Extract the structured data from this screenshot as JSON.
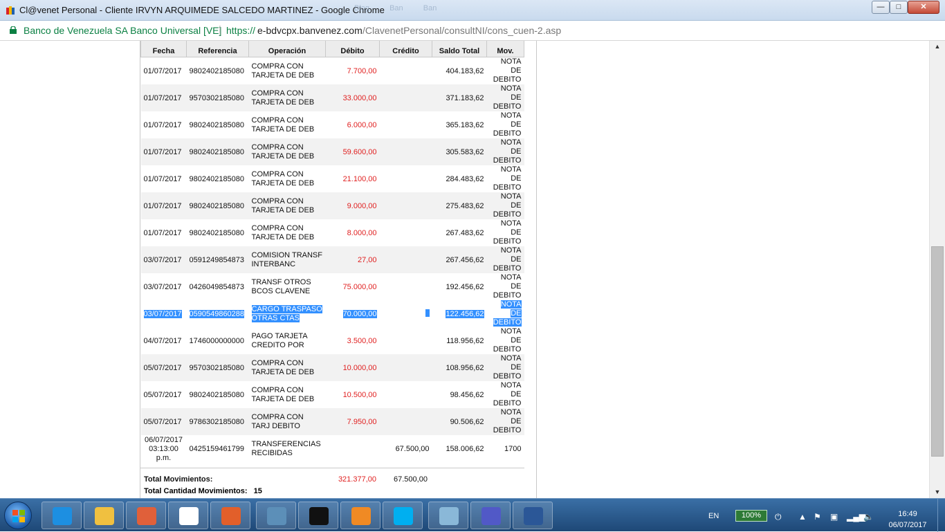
{
  "window": {
    "title": "Cl@venet Personal - Cliente IRVYN ARQUIMEDE SALCEDO MARTINEZ - Google Chrome",
    "ghost_tabs": [
      "Blog",
      "Ban",
      "Ban"
    ],
    "controls": {
      "minimize": "—",
      "maximize": "□",
      "close": "✕"
    }
  },
  "address": {
    "org": "Banco de Venezuela SA Banco Universal [VE]",
    "separator": "|",
    "scheme": "https://",
    "domain": "e-bdvcpx.banvenez.com",
    "path": "/ClavenetPersonal/consultNI/cons_cuen-2.asp"
  },
  "table": {
    "headers": {
      "fecha": "Fecha",
      "referencia": "Referencia",
      "operacion": "Operación",
      "debito": "Débito",
      "credito": "Crédito",
      "saldo": "Saldo Total",
      "tipo": "Mov."
    },
    "rows": [
      {
        "fecha": "01/07/2017",
        "referencia": "9802402185080",
        "operacion": "COMPRA CON TARJETA DE DEB",
        "debito": "7.700,00",
        "credito": "",
        "saldo": "404.183,62",
        "tipo": "NOTA DE DEBITO"
      },
      {
        "fecha": "01/07/2017",
        "referencia": "9570302185080",
        "operacion": "COMPRA CON TARJETA DE DEB",
        "debito": "33.000,00",
        "credito": "",
        "saldo": "371.183,62",
        "tipo": "NOTA DE DEBITO"
      },
      {
        "fecha": "01/07/2017",
        "referencia": "9802402185080",
        "operacion": "COMPRA CON TARJETA DE DEB",
        "debito": "6.000,00",
        "credito": "",
        "saldo": "365.183,62",
        "tipo": "NOTA DE DEBITO"
      },
      {
        "fecha": "01/07/2017",
        "referencia": "9802402185080",
        "operacion": "COMPRA CON TARJETA DE DEB",
        "debito": "59.600,00",
        "credito": "",
        "saldo": "305.583,62",
        "tipo": "NOTA DE DEBITO"
      },
      {
        "fecha": "01/07/2017",
        "referencia": "9802402185080",
        "operacion": "COMPRA CON TARJETA DE DEB",
        "debito": "21.100,00",
        "credito": "",
        "saldo": "284.483,62",
        "tipo": "NOTA DE DEBITO"
      },
      {
        "fecha": "01/07/2017",
        "referencia": "9802402185080",
        "operacion": "COMPRA CON TARJETA DE DEB",
        "debito": "9.000,00",
        "credito": "",
        "saldo": "275.483,62",
        "tipo": "NOTA DE DEBITO"
      },
      {
        "fecha": "01/07/2017",
        "referencia": "9802402185080",
        "operacion": "COMPRA CON TARJETA DE DEB",
        "debito": "8.000,00",
        "credito": "",
        "saldo": "267.483,62",
        "tipo": "NOTA DE DEBITO"
      },
      {
        "fecha": "03/07/2017",
        "referencia": "0591249854873",
        "operacion": "COMISION TRANSF INTERBANC",
        "debito": "27,00",
        "credito": "",
        "saldo": "267.456,62",
        "tipo": "NOTA DE DEBITO"
      },
      {
        "fecha": "03/07/2017",
        "referencia": "0426049854873",
        "operacion": "TRANSF OTROS BCOS CLAVENE",
        "debito": "75.000,00",
        "credito": "",
        "saldo": "192.456,62",
        "tipo": "NOTA DE DEBITO"
      },
      {
        "fecha": "03/07/2017",
        "referencia": "0590549860288",
        "operacion": "CARGO TRASPASO OTRAS CTAS",
        "debito": "70.000,00",
        "credito": "",
        "saldo": "122.456,62",
        "tipo": "NOTA DE DEBITO"
      },
      {
        "fecha": "04/07/2017",
        "referencia": "1746000000000",
        "operacion": "PAGO TARJETA CREDITO POR",
        "debito": "3.500,00",
        "credito": "",
        "saldo": "118.956,62",
        "tipo": "NOTA DE DEBITO"
      },
      {
        "fecha": "05/07/2017",
        "referencia": "9570302185080",
        "operacion": "COMPRA CON TARJETA DE DEB",
        "debito": "10.000,00",
        "credito": "",
        "saldo": "108.956,62",
        "tipo": "NOTA DE DEBITO"
      },
      {
        "fecha": "05/07/2017",
        "referencia": "9802402185080",
        "operacion": "COMPRA CON TARJETA DE DEB",
        "debito": "10.500,00",
        "credito": "",
        "saldo": "98.456,62",
        "tipo": "NOTA DE DEBITO"
      },
      {
        "fecha": "05/07/2017",
        "referencia": "9786302185080",
        "operacion": "COMPRA CON TARJ DEBITO",
        "debito": "7.950,00",
        "credito": "",
        "saldo": "90.506,62",
        "tipo": "NOTA DE DEBITO"
      }
    ],
    "last_row": {
      "fecha": "06/07/2017 03:13:00 p.m.",
      "referencia": "0425159461799",
      "operacion": "TRANSFERENCIAS RECIBIDAS",
      "debito": "",
      "credito": "67.500,00",
      "saldo": "158.006,62",
      "tipo": "1700"
    }
  },
  "totals": {
    "movimientos_label": "Total Movimientos:",
    "debito": "321.377,00",
    "credito": "67.500,00",
    "cantidad_label": "Total Cantidad Movimientos:",
    "cantidad": "15"
  },
  "colors": {
    "debit": "#e02020",
    "selection": "#3390ff",
    "secure": "#0b8043"
  },
  "taskbar": {
    "items": [
      "internet-explorer",
      "file-explorer",
      "media-player",
      "chrome",
      "app-orange",
      "photo-viewer",
      "command-prompt",
      "sublime-text",
      "skype",
      "notes",
      "teams",
      "word"
    ],
    "lang": "EN",
    "battery": "100%",
    "time": "16:49",
    "date": "06/07/2017"
  }
}
